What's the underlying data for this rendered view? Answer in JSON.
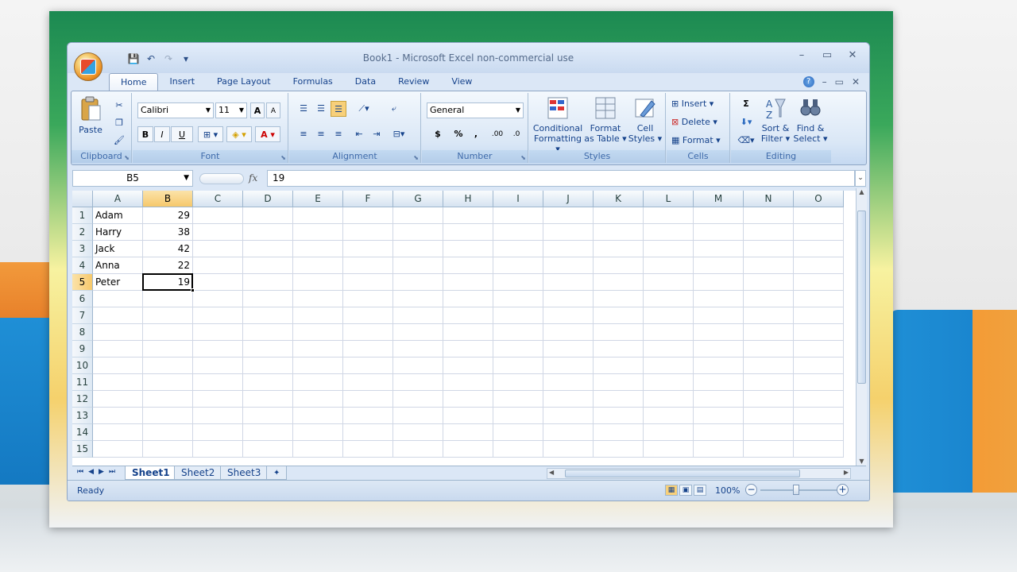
{
  "window": {
    "title": "Book1 - Microsoft Excel non-commercial use",
    "controls": {
      "minimize": "–",
      "maximize": "▭",
      "close": "✕"
    }
  },
  "quick_access": {
    "save": "💾",
    "undo": "↶",
    "redo": "↷",
    "customize": "▾"
  },
  "ribbon_tabs": [
    "Home",
    "Insert",
    "Page Layout",
    "Formulas",
    "Data",
    "Review",
    "View"
  ],
  "ribbon_right": {
    "help": "?",
    "minimize": "–",
    "restore": "▭",
    "close": "✕"
  },
  "groups": {
    "clipboard": {
      "label": "Clipboard",
      "paste": "Paste"
    },
    "font": {
      "label": "Font",
      "name": "Calibri",
      "size": "11",
      "bold": "B",
      "italic": "I",
      "underline": "U",
      "grow": "A",
      "shrink": "A"
    },
    "alignment": {
      "label": "Alignment"
    },
    "number": {
      "label": "Number",
      "format": "General",
      "currency": "$",
      "percent": "%",
      "comma": ",",
      "inc_decimal": ".00",
      "dec_decimal": ".0"
    },
    "styles": {
      "label": "Styles",
      "conditional": "Conditional",
      "conditional2": "Formatting",
      "format_table": "Format",
      "format_table2": "as Table",
      "cell_styles": "Cell",
      "cell_styles2": "Styles"
    },
    "cells": {
      "label": "Cells",
      "insert": "Insert",
      "delete": "Delete",
      "format": "Format"
    },
    "editing": {
      "label": "Editing",
      "sum": "Σ",
      "sort": "Sort &",
      "sort2": "Filter",
      "find": "Find &",
      "find2": "Select"
    }
  },
  "formula_bar": {
    "name_box": "B5",
    "fx": "fx",
    "value": "19"
  },
  "columns": [
    "A",
    "B",
    "C",
    "D",
    "E",
    "F",
    "G",
    "H",
    "I",
    "J",
    "K",
    "L",
    "M",
    "N",
    "O"
  ],
  "rows": [
    "1",
    "2",
    "3",
    "4",
    "5",
    "6",
    "7",
    "8",
    "9",
    "10",
    "11",
    "12",
    "13",
    "14",
    "15"
  ],
  "cells": [
    {
      "name": "Adam",
      "value": "29"
    },
    {
      "name": "Harry",
      "value": "38"
    },
    {
      "name": "Jack",
      "value": "42"
    },
    {
      "name": "Anna",
      "value": "22"
    },
    {
      "name": "Peter",
      "value": "19"
    }
  ],
  "selected": {
    "column": "B",
    "row": "5"
  },
  "sheet_nav": [
    "⏮",
    "◀",
    "▶",
    "⏭"
  ],
  "sheets": [
    "Sheet1",
    "Sheet2",
    "Sheet3"
  ],
  "status": {
    "text": "Ready",
    "zoom": "100%",
    "zoom_minus": "−",
    "zoom_plus": "+"
  }
}
